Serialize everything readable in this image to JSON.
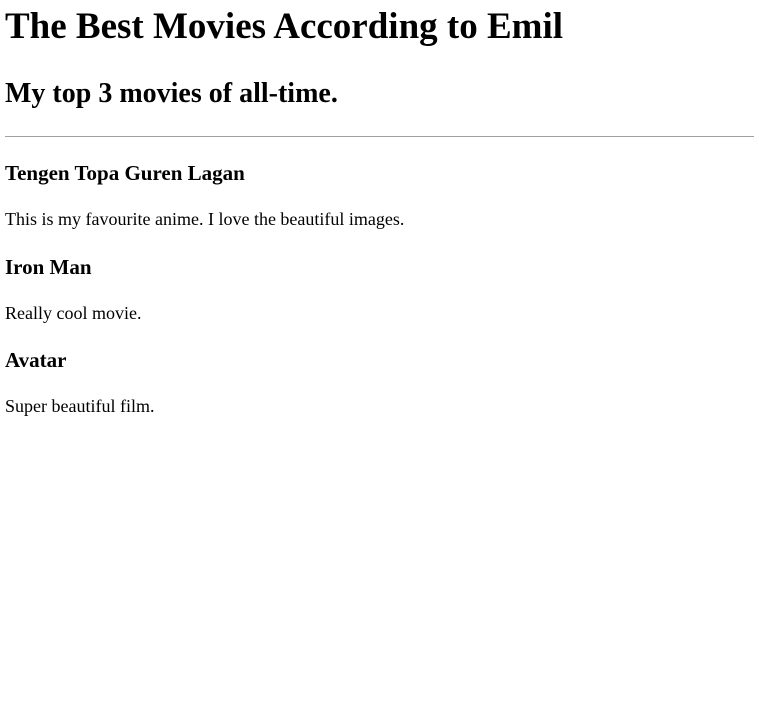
{
  "page": {
    "title": "The Best Movies According to Emil",
    "subtitle": "My top 3 movies of all-time."
  },
  "movies": [
    {
      "title": "Tengen Topa Guren Lagan",
      "description": "This is my favourite anime. I love the beautiful images."
    },
    {
      "title": "Iron Man",
      "description": "Really cool movie."
    },
    {
      "title": "Avatar",
      "description": "Super beautiful film."
    }
  ]
}
